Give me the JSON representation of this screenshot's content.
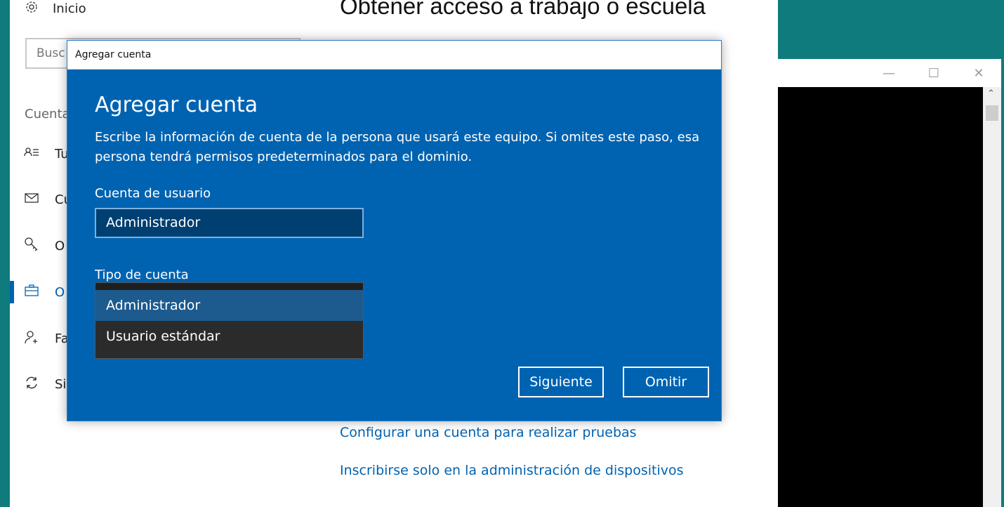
{
  "settings": {
    "home_label": "Inicio",
    "search_placeholder": "Busc",
    "section_label": "Cuenta",
    "nav_items": [
      {
        "label": "Tu",
        "icon": "user-info-icon"
      },
      {
        "label": "Cu",
        "icon": "mail-icon"
      },
      {
        "label": "O",
        "icon": "key-icon"
      },
      {
        "label": "O",
        "icon": "briefcase-icon",
        "selected": true
      },
      {
        "label": "Fa",
        "icon": "add-user-icon"
      },
      {
        "label": "Si",
        "icon": "sync-icon"
      }
    ],
    "page_title": "Obtener acceso a trabajo o escuela",
    "links": [
      "Configurar una cuenta para realizar pruebas",
      "Inscribirse solo en la administración de dispositivos"
    ]
  },
  "right_window": {
    "controls": [
      "minimize-icon",
      "maximize-icon",
      "close-icon"
    ]
  },
  "dialog": {
    "window_title": "Agregar cuenta",
    "heading": "Agregar cuenta",
    "description": "Escribe la información de cuenta de la persona que usará este equipo. Si omites este paso, esa persona tendrá permisos predeterminados para el dominio.",
    "user_account_label": "Cuenta de usuario",
    "user_account_value": "Administrador",
    "account_type_label": "Tipo de cuenta",
    "account_type_options": [
      "Administrador",
      "Usuario estándar"
    ],
    "account_type_selected": "Administrador",
    "next_button": "Siguiente",
    "skip_button": "Omitir"
  },
  "colors": {
    "accent": "#0063b1",
    "desktop": "#0f7b7c"
  }
}
